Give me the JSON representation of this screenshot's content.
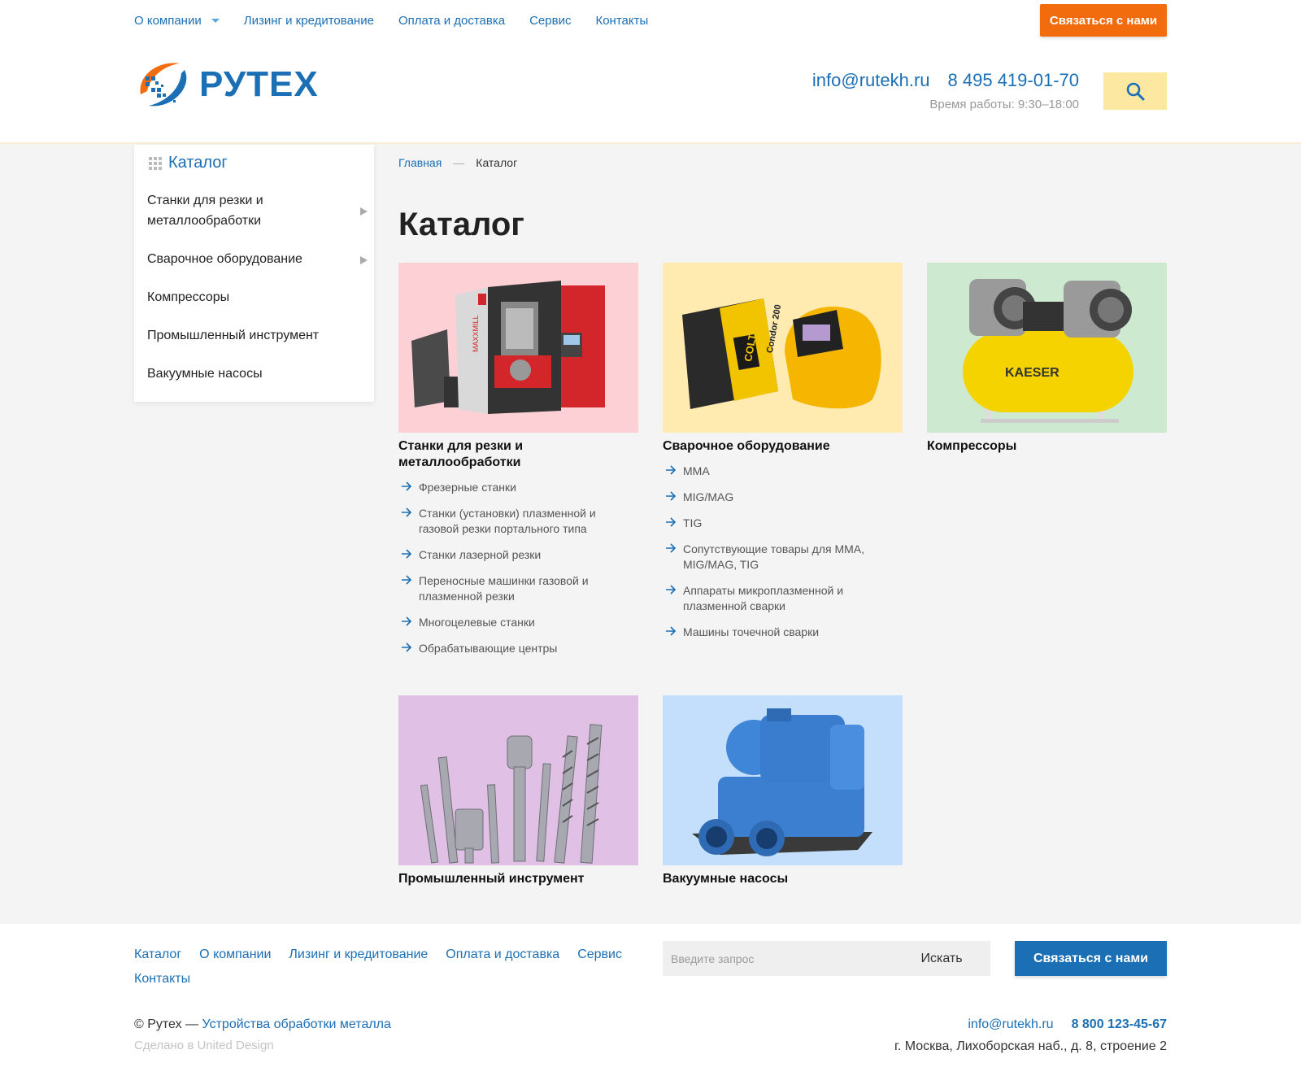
{
  "topnav": {
    "items": [
      "О компании",
      "Лизинг и кредитование",
      "Оплата и доставка",
      "Сервис",
      "Контакты"
    ],
    "contact_button": "Связаться с нами"
  },
  "header": {
    "logo_text": "РУТЕХ",
    "email": "info@rutekh.ru",
    "phone": "8 495 419-01-70",
    "hours": "Время работы: 9:30–18:00"
  },
  "sidebar": {
    "title": "Каталог",
    "items": [
      {
        "label": "Станки для резки и металлообработки"
      },
      {
        "label": "Сварочное оборудование"
      },
      {
        "label": "Компрессоры"
      },
      {
        "label": "Промышленный инструмент"
      },
      {
        "label": "Вакуумные насосы"
      }
    ]
  },
  "breadcrumb": {
    "home": "Главная",
    "separator": "—",
    "current": "Каталог"
  },
  "page_title": "Каталог",
  "cards": [
    {
      "name": "Станки для резки и металлообработки",
      "bg": "#fdd0d6",
      "links": [
        "Фрезерные станки",
        "Станки (установки) плазменной и газовой резки портального типа",
        "Станки лазерной резки",
        "Переносные машинки газовой и плазменной резки",
        "Многоцелевые станки",
        "Обрабатывающие центры"
      ]
    },
    {
      "name": "Сварочное оборудование",
      "bg": "#ffeab0",
      "links": [
        "MMA",
        "MIG/MAG",
        "TIG",
        "Сопутствующие товары для MMA, MIG/MAG, TIG",
        "Аппараты микроплазменной и плазменной сварки",
        "Машины точечной сварки"
      ]
    },
    {
      "name": "Компрессоры",
      "bg": "#cde9cf",
      "links": []
    },
    {
      "name": "Промышленный инструмент",
      "bg": "#e0c0e4",
      "links": []
    },
    {
      "name": "Вакуумные насосы",
      "bg": "#c3dffb",
      "links": []
    }
  ],
  "image_labels": {
    "machine": "MAXXMILL",
    "welder": "COLT",
    "welder_sub": "Condor 200",
    "compressor": "KAESER"
  },
  "footer": {
    "nav": [
      "Каталог",
      "О компании",
      "Лизинг и кредитование",
      "Оплата и доставка",
      "Сервис",
      "Контакты"
    ],
    "search_placeholder": "Введите запрос",
    "search_button": "Искать",
    "contact_button": "Связаться с нами",
    "copyright_prefix": "© Рутех — ",
    "copyright_link": "Устройства обработки металла",
    "made_by": "Сделано в United Design",
    "email": "info@rutekh.ru",
    "phone": "8 800 123-45-67",
    "address": "г. Москва, Лихоборская наб., д. 8, строение 2"
  },
  "colors": {
    "brand_blue": "#1b6fb5",
    "accent_orange": "#f26b0c",
    "search_yellow": "#fde8a2"
  },
  "icons": [
    "caret-down-icon",
    "logo-mark-icon",
    "search-icon",
    "grid-icon",
    "chevron-right-icon",
    "arrow-right-icon"
  ]
}
